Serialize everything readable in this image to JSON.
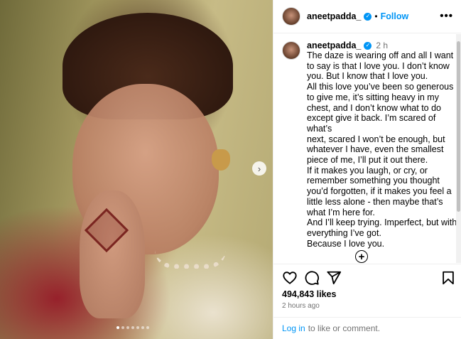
{
  "post": {
    "username": "aneetpadda_",
    "follow_label": "Follow",
    "separator": "•",
    "more_label": "•••",
    "next_label": "›",
    "carousel_count": 7,
    "carousel_active_index": 0
  },
  "caption": {
    "username": "aneetpadda_",
    "time": "2 h",
    "text": "The daze is wearing off and all I want\nto say is that I love you. I don’t know\nyou. But I know that I love you.\nAll this love you’ve been so generous\nto give me, it’s sitting heavy in my\nchest, and I don’t know what to do\nexcept give it back. I’m scared of what’s\nnext, scared I won’t be enough, but\nwhatever I have, even the smallest\npiece of me, I’ll put it out there.\nIf it makes you laugh, or cry, or\nremember something you thought\nyou’d forgotten, if it makes you feel a\nlittle less alone - then maybe that’s\nwhat I’m here for.\nAnd I’ll keep trying. Imperfect, but with\neverything I’ve got.\nBecause I love you.",
    "add_label": "+"
  },
  "stats": {
    "likes": "494,843 likes",
    "posted_ago": "2 hours ago"
  },
  "footer": {
    "login_link": "Log in",
    "login_suffix": "to like or comment."
  },
  "icons": {
    "verified": "verified-badge-icon",
    "like": "heart-icon",
    "comment": "comment-bubble-icon",
    "share": "paper-plane-icon",
    "save": "bookmark-icon",
    "add_comment": "plus-circle-icon"
  },
  "colors": {
    "accent": "#0095f6",
    "muted_text": "#737373",
    "divider": "#efefef"
  }
}
